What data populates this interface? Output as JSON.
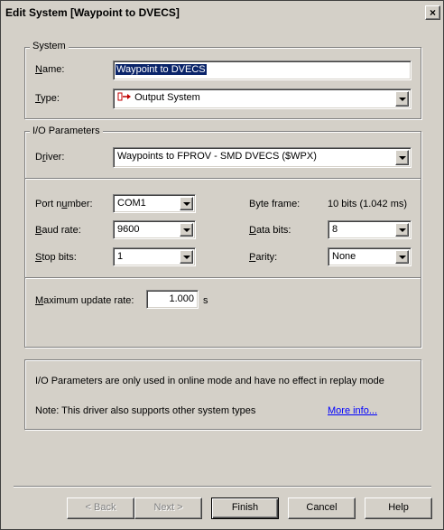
{
  "window": {
    "title": "Edit System [Waypoint to DVECS]",
    "close_glyph": "×"
  },
  "system_group": {
    "legend": "System",
    "name_label": "Name:",
    "name_value": "Waypoint to DVECS",
    "type_label": "Type:",
    "type_value": "Output System"
  },
  "io_group": {
    "legend": "I/O Parameters",
    "driver_label": "Driver:",
    "driver_value": "Waypoints to FPROV - SMD DVECS ($WPX)",
    "port_label": "Port number:",
    "port_value": "COM1",
    "baud_label": "Baud rate:",
    "baud_value": "9600",
    "stop_label": "Stop bits:",
    "stop_value": "1",
    "byteframe_label": "Byte frame:",
    "byteframe_value": "10 bits (1.042 ms)",
    "databits_label": "Data bits:",
    "databits_value": "8",
    "parity_label": "Parity:",
    "parity_value": "None",
    "maxrate_label": "Maximum update rate:",
    "maxrate_value": "1.000",
    "maxrate_unit": "s"
  },
  "info": {
    "line1": "I/O Parameters are only used in online mode and have no effect in replay mode",
    "line2": "Note: This driver also supports other system types",
    "more_link": "More info..."
  },
  "buttons": {
    "back": "< Back",
    "next": "Next >",
    "finish": "Finish",
    "cancel": "Cancel",
    "help": "Help"
  },
  "icons": {
    "type_icon": "output-system-icon"
  }
}
